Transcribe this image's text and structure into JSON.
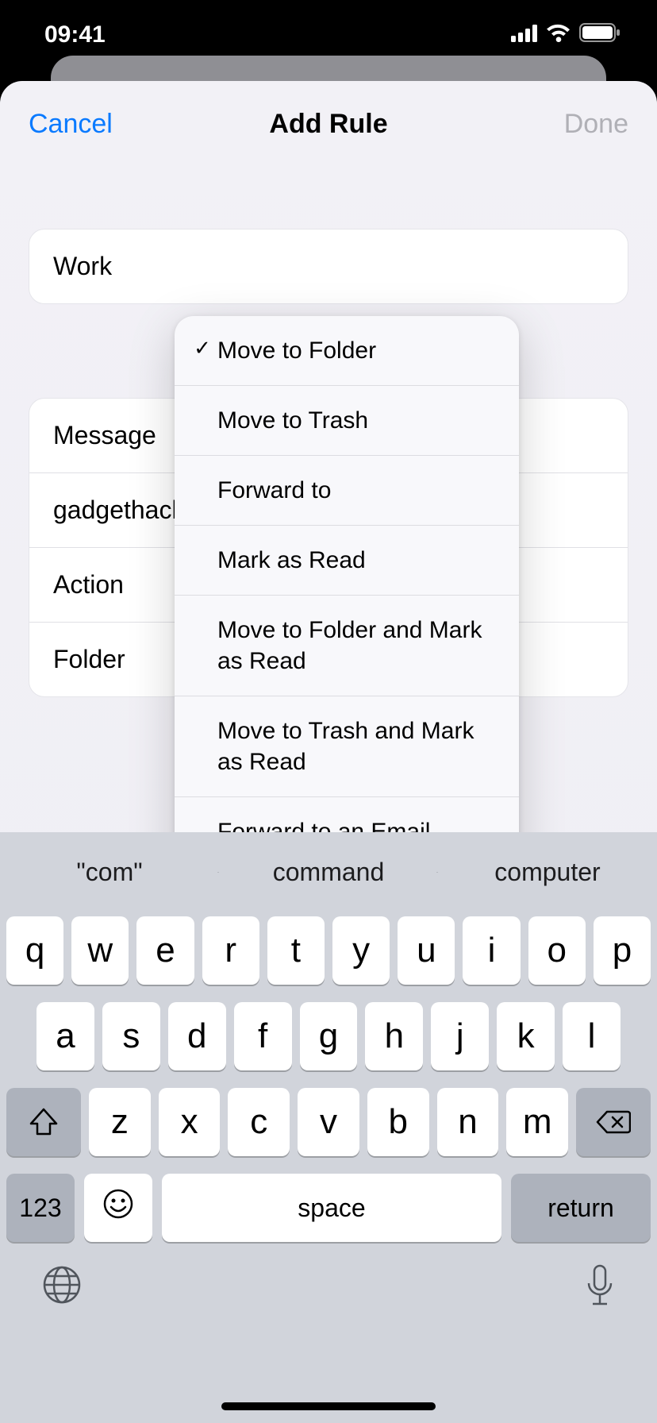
{
  "status": {
    "time": "09:41"
  },
  "nav": {
    "title": "Add Rule",
    "left": "Cancel",
    "right": "Done"
  },
  "field": {
    "name": "Work"
  },
  "rows": {
    "r0": "Message",
    "r1": "gadgethacks·",
    "r2": "Action",
    "r3": "Folder"
  },
  "dropdown": {
    "items": [
      {
        "label": "Move to Folder",
        "checked": true
      },
      {
        "label": "Move to Trash",
        "checked": false
      },
      {
        "label": "Forward to",
        "checked": false
      },
      {
        "label": "Mark as Read",
        "checked": false
      },
      {
        "label": "Move to Folder and Mark as Read",
        "checked": false
      },
      {
        "label": "Move to Trash and Mark as Read",
        "checked": false
      },
      {
        "label": "Forward to an Email Address and Mark as Read",
        "checked": false
      }
    ]
  },
  "keyboard": {
    "predictions": [
      "\"com\"",
      "command",
      "computer"
    ],
    "row1": [
      "q",
      "w",
      "e",
      "r",
      "t",
      "y",
      "u",
      "i",
      "o",
      "p"
    ],
    "row2": [
      "a",
      "s",
      "d",
      "f",
      "g",
      "h",
      "j",
      "k",
      "l"
    ],
    "row3": [
      "z",
      "x",
      "c",
      "v",
      "b",
      "n",
      "m"
    ],
    "num": "123",
    "space": "space",
    "return": "return"
  }
}
